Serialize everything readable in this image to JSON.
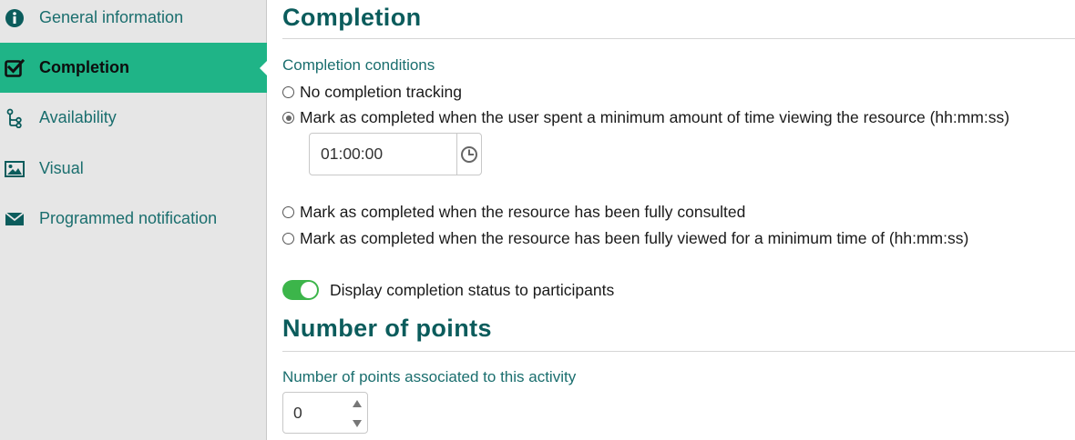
{
  "sidebar": {
    "items": [
      {
        "label": "General information",
        "icon": "info-icon"
      },
      {
        "label": "Completion",
        "icon": "checkbox-icon",
        "active": true
      },
      {
        "label": "Availability",
        "icon": "branch-icon"
      },
      {
        "label": "Visual",
        "icon": "image-icon"
      },
      {
        "label": "Programmed notification",
        "icon": "envelope-icon"
      }
    ]
  },
  "completion": {
    "title": "Completion",
    "conditions_label": "Completion conditions",
    "options": [
      {
        "label": "No completion tracking",
        "checked": false
      },
      {
        "label": "Mark as completed when the user spent a minimum amount of time viewing the resource (hh:mm:ss)",
        "checked": true
      },
      {
        "label": "Mark as completed when the resource has been fully consulted",
        "checked": false
      },
      {
        "label": "Mark as completed when the resource has been fully viewed for a minimum time of (hh:mm:ss)",
        "checked": false
      }
    ],
    "min_time_value": "01:00:00",
    "display_status_label": "Display completion status to participants",
    "display_status_on": true
  },
  "points": {
    "title": "Number of points",
    "field_label": "Number of points associated to this activity",
    "value": "0"
  },
  "colors": {
    "accent": "#1fb487",
    "heading": "#0b5c5c",
    "link": "#1a6e6e",
    "toggle_on": "#3cb54a",
    "sidebar_bg": "#e6e6e6"
  }
}
